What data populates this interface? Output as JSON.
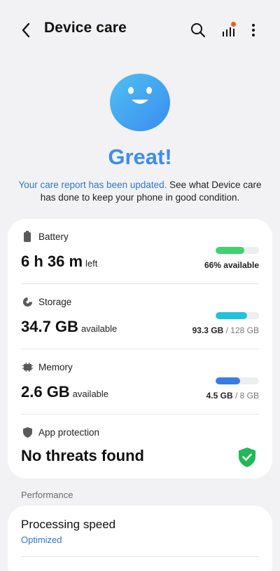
{
  "header": {
    "title": "Device care",
    "back_icon": "back-arrow-icon",
    "search_icon": "search-icon",
    "stats_icon": "usage-stats-icon",
    "more_icon": "more-vertical-icon",
    "notification_dot_color": "#f05a28"
  },
  "hero": {
    "icon": "smiley-face-icon",
    "status": "Great!",
    "summary_link": "Your care report has been updated.",
    "summary_rest": "See what Device care has done to keep your phone in good condition.",
    "status_color": "#3d8ee8"
  },
  "items": {
    "battery": {
      "icon": "battery-icon",
      "label": "Battery",
      "value": "6 h 36 m",
      "unit": "left",
      "meta_bold": "66% available",
      "level": 0.66,
      "bar_color": "#3fd26a"
    },
    "storage": {
      "icon": "storage-pie-icon",
      "label": "Storage",
      "value": "34.7 GB",
      "unit": "available",
      "meta_bold": "93.3 GB",
      "meta_rest": " / 128 GB",
      "level": 0.73,
      "bar_color": "#22c3da"
    },
    "memory": {
      "icon": "memory-chip-icon",
      "label": "Memory",
      "value": "2.6 GB",
      "unit": "available",
      "meta_bold": "4.5 GB",
      "meta_rest": " / 8 GB",
      "level": 0.56,
      "bar_color": "#3b7be6"
    },
    "protection": {
      "icon": "shield-icon",
      "label": "App protection",
      "value": "No threats found",
      "status_icon": "shield-check-icon",
      "status_color": "#22b85a"
    }
  },
  "performance": {
    "section_label": "Performance",
    "title": "Processing speed",
    "subtitle": "Optimized"
  }
}
